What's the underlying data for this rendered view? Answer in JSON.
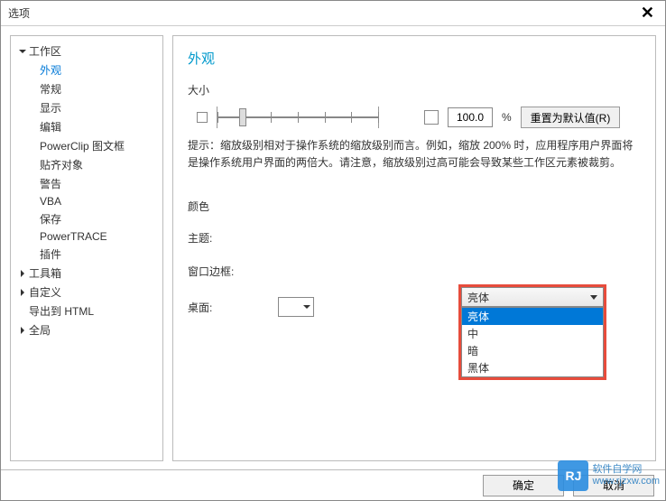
{
  "window": {
    "title": "选项"
  },
  "sidebar": {
    "items": [
      {
        "label": "工作区",
        "level": 0,
        "arrow": "down"
      },
      {
        "label": "外观",
        "level": 1,
        "selected": true
      },
      {
        "label": "常规",
        "level": 1
      },
      {
        "label": "显示",
        "level": 1
      },
      {
        "label": "编辑",
        "level": 1
      },
      {
        "label": "PowerClip 图文框",
        "level": 1
      },
      {
        "label": "贴齐对象",
        "level": 1
      },
      {
        "label": "警告",
        "level": 1
      },
      {
        "label": "VBA",
        "level": 1
      },
      {
        "label": "保存",
        "level": 1
      },
      {
        "label": "PowerTRACE",
        "level": 1
      },
      {
        "label": "插件",
        "level": 1
      },
      {
        "label": "工具箱",
        "level": 0,
        "arrow": "right"
      },
      {
        "label": "自定义",
        "level": 0,
        "arrow": "right"
      },
      {
        "label": "导出到 HTML",
        "level": 0
      },
      {
        "label": "全局",
        "level": 0,
        "arrow": "right"
      }
    ]
  },
  "main": {
    "title": "外观",
    "size_label": "大小",
    "value": "100.0",
    "percent": "%",
    "reset_label": "重置为默认值(R)",
    "hint": "提示：缩放级别相对于操作系统的缩放级别而言。例如，缩放 200% 时，应用程序用户界面将是操作系统用户界面的两倍大。请注意，缩放级别过高可能会导致某些工作区元素被裁剪。",
    "color_label": "颜色",
    "theme_label": "主题:",
    "theme_value": "亮体",
    "border_label": "窗口边框:",
    "desktop_label": "桌面:",
    "theme_options": [
      "亮体",
      "中",
      "暗",
      "黑体"
    ]
  },
  "footer": {
    "ok": "确定",
    "cancel": "取消"
  },
  "watermark": {
    "logo": "RJ",
    "line1": "软件自学网",
    "line2": "www.rjzxw.com"
  }
}
